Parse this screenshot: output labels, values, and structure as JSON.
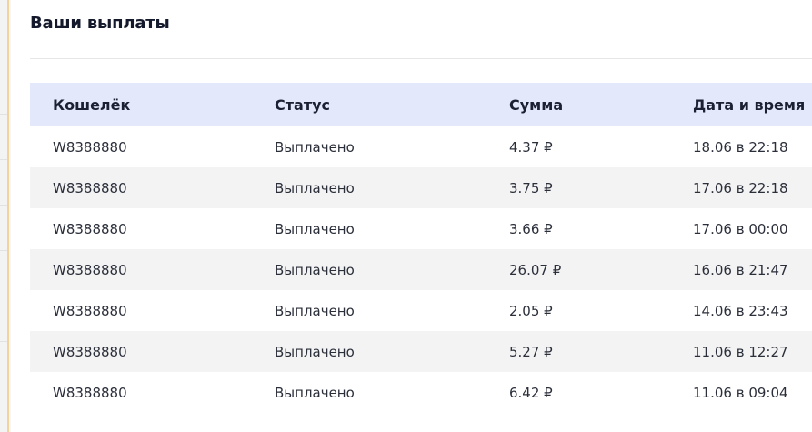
{
  "payouts": {
    "title": "Ваши выплаты",
    "columns": {
      "wallet": "Кошелёк",
      "status": "Статус",
      "amount": "Сумма",
      "datetime": "Дата и время"
    },
    "rows": [
      {
        "wallet": "W8388880",
        "status": "Выплачено",
        "amount": "4.37 ₽",
        "datetime": "18.06 в 22:18"
      },
      {
        "wallet": "W8388880",
        "status": "Выплачено",
        "amount": "3.75 ₽",
        "datetime": "17.06 в 22:18"
      },
      {
        "wallet": "W8388880",
        "status": "Выплачено",
        "amount": "3.66 ₽",
        "datetime": "17.06 в 00:00"
      },
      {
        "wallet": "W8388880",
        "status": "Выплачено",
        "amount": "26.07 ₽",
        "datetime": "16.06 в 21:47"
      },
      {
        "wallet": "W8388880",
        "status": "Выплачено",
        "amount": "2.05 ₽",
        "datetime": "14.06 в 23:43"
      },
      {
        "wallet": "W8388880",
        "status": "Выплачено",
        "amount": "5.27 ₽",
        "datetime": "11.06 в 12:27"
      },
      {
        "wallet": "W8388880",
        "status": "Выплачено",
        "amount": "6.42 ₽",
        "datetime": "11.06 в 09:04"
      }
    ]
  },
  "colors": {
    "header_background": "#e4e8fb",
    "striped_row_background": "#f3f3f3",
    "left_accent_border": "#f2d49a",
    "title_text": "#141a2b"
  }
}
